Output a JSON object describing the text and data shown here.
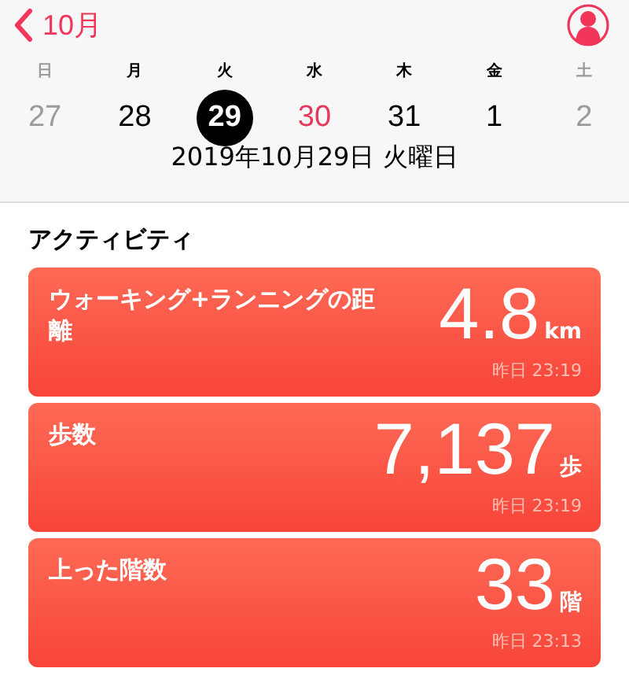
{
  "nav": {
    "back_label": "10月"
  },
  "week": [
    {
      "weekday": "日",
      "date": "27",
      "kind": "weekend",
      "selected": false
    },
    {
      "weekday": "月",
      "date": "28",
      "kind": "weekday",
      "selected": false
    },
    {
      "weekday": "火",
      "date": "29",
      "kind": "weekday",
      "selected": true
    },
    {
      "weekday": "水",
      "date": "30",
      "kind": "accent",
      "selected": false
    },
    {
      "weekday": "木",
      "date": "31",
      "kind": "weekday",
      "selected": false
    },
    {
      "weekday": "金",
      "date": "1",
      "kind": "weekday",
      "selected": false
    },
    {
      "weekday": "土",
      "date": "2",
      "kind": "weekend",
      "selected": false
    }
  ],
  "selected_date": "2019年10月29日 火曜日",
  "section_title": "アクティビティ",
  "cards": [
    {
      "label": "ウォーキング+ランニングの距離",
      "value": "4.8",
      "unit": "km",
      "time": "昨日 23:19"
    },
    {
      "label": "歩数",
      "value": "7,137",
      "unit": "歩",
      "time": "昨日 23:19"
    },
    {
      "label": "上った階数",
      "value": "33",
      "unit": "階",
      "time": "昨日 23:13"
    }
  ]
}
